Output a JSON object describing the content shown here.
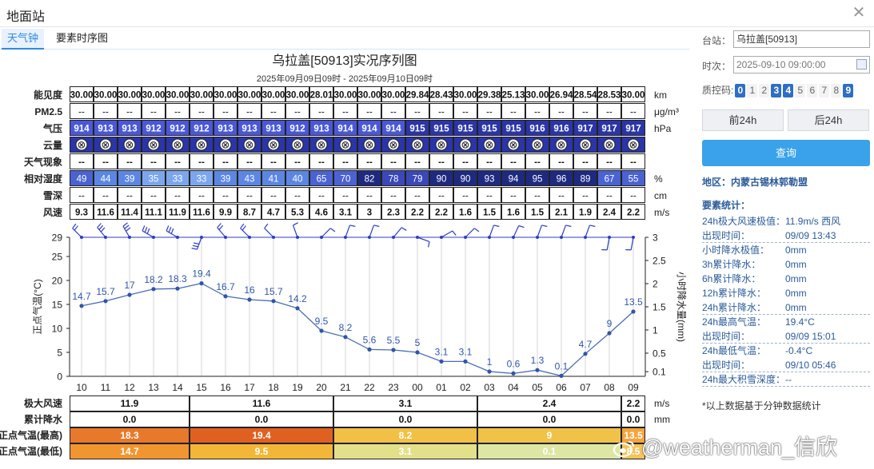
{
  "window": {
    "title": "地面站"
  },
  "tabs": [
    {
      "label": "天气钟",
      "active": true
    },
    {
      "label": "要素时序图",
      "active": false
    }
  ],
  "chart_data": {
    "type": "line",
    "title": "乌拉盖[50913]实况序列图",
    "subtitle": "2025年09月09日09时 - 2025年09月10日09时",
    "hours": [
      "10",
      "11",
      "12",
      "13",
      "14",
      "15",
      "16",
      "17",
      "18",
      "19",
      "20",
      "21",
      "22",
      "23",
      "00",
      "01",
      "02",
      "03",
      "04",
      "05",
      "06",
      "07",
      "08",
      "09"
    ],
    "table_rows": [
      {
        "label": "能见度",
        "unit": "km",
        "style": "plain-bold",
        "values": [
          "30.00",
          "30.00",
          "30.00",
          "30.00",
          "30.00",
          "30.00",
          "30.00",
          "30.00",
          "30.00",
          "30.00",
          "28.01",
          "30.00",
          "30.00",
          "30.00",
          "29.84",
          "28.43",
          "30.00",
          "29.38",
          "25.13",
          "30.00",
          "26.94",
          "28.54",
          "28.53",
          "30.00"
        ]
      },
      {
        "label": "PM2.5",
        "unit": "μg/m³",
        "style": "plain",
        "values": [
          "--",
          "--",
          "--",
          "--",
          "--",
          "--",
          "--",
          "--",
          "--",
          "--",
          "--",
          "--",
          "--",
          "--",
          "--",
          "--",
          "--",
          "--",
          "--",
          "--",
          "--",
          "--",
          "--",
          "--"
        ]
      },
      {
        "label": "气压",
        "unit": "hPa",
        "style": "pressure",
        "values": [
          "914",
          "913",
          "913",
          "912",
          "912",
          "912",
          "913",
          "913",
          "913",
          "912",
          "913",
          "914",
          "914",
          "914",
          "915",
          "915",
          "915",
          "915",
          "915",
          "916",
          "916",
          "917",
          "917",
          "917"
        ]
      },
      {
        "label": "云量",
        "unit": "",
        "style": "cloud",
        "values": [
          "⊗",
          "⊗",
          "⊗",
          "⊗",
          "⊗",
          "⊗",
          "⊗",
          "⊗",
          "⊗",
          "⊗",
          "⊗",
          "⊗",
          "⊗",
          "⊗",
          "⊗",
          "⊗",
          "⊗",
          "⊗",
          "⊗",
          "⊗",
          "⊗",
          "⊗",
          "⊗",
          "⊗"
        ]
      },
      {
        "label": "天气现象",
        "unit": "",
        "style": "plain-bold",
        "values": [
          "--",
          "--",
          "--",
          "--",
          "--",
          "--",
          "--",
          "--",
          "--",
          "--",
          "--",
          "--",
          "--",
          "--",
          "--",
          "--",
          "--",
          "--",
          "--",
          "--",
          "--",
          "--",
          "--",
          "--"
        ]
      },
      {
        "label": "相对湿度",
        "unit": "%",
        "style": "humidity",
        "values": [
          "49",
          "44",
          "39",
          "35",
          "33",
          "33",
          "39",
          "43",
          "41",
          "40",
          "65",
          "70",
          "82",
          "78",
          "79",
          "90",
          "90",
          "93",
          "94",
          "95",
          "96",
          "89",
          "67",
          "55"
        ]
      },
      {
        "label": "雪深",
        "unit": "cm",
        "style": "plain",
        "values": [
          "--",
          "--",
          "--",
          "--",
          "--",
          "--",
          "--",
          "--",
          "--",
          "--",
          "--",
          "--",
          "--",
          "--",
          "--",
          "--",
          "--",
          "--",
          "--",
          "--",
          "--",
          "--",
          "--",
          "--"
        ]
      },
      {
        "label": "风速",
        "unit": "m/s",
        "style": "plain-bold",
        "values": [
          "9.3",
          "11.6",
          "11.4",
          "11.1",
          "11.9",
          "11.6",
          "9.9",
          "8.7",
          "4.7",
          "5.3",
          "4.6",
          "3.1",
          "3",
          "2.3",
          "2.2",
          "2.2",
          "1.6",
          "1.5",
          "1.6",
          "1.5",
          "2.1",
          "1.9",
          "2.4",
          "2.2"
        ]
      }
    ],
    "temperature": {
      "name": "正点气温(°C)",
      "values": [
        14.7,
        15.7,
        17,
        18.2,
        18.3,
        19.4,
        16.7,
        16,
        15.7,
        14.2,
        9.5,
        8.2,
        5.6,
        5.5,
        5,
        3.1,
        3.1,
        1,
        0.6,
        1.3,
        0.1,
        4.7,
        9,
        13.5
      ]
    },
    "precip_1h": {
      "name": "小时降水量(mm)",
      "values": [
        0,
        0,
        0,
        0,
        0,
        0,
        0,
        0,
        0,
        0,
        0,
        0,
        0,
        0,
        0,
        0,
        0,
        0,
        0,
        0,
        0,
        0,
        0,
        0
      ]
    },
    "left_axis": {
      "label": "正点气温(°C)",
      "ylim": [
        0,
        29
      ],
      "ticks": [
        "29",
        "25",
        "20",
        "15",
        "10",
        "5",
        "0"
      ]
    },
    "right_axis": {
      "label": "小时降水量(mm)",
      "ylim": [
        0,
        3
      ],
      "ticks": [
        "3",
        "2.5",
        "2",
        "1.5",
        "1",
        "0.5",
        "0.1"
      ]
    },
    "wind_dir_deg": [
      315,
      320,
      330,
      300,
      300,
      200,
      320,
      315,
      315,
      340,
      45,
      20,
      20,
      40,
      110,
      60,
      45,
      20,
      25,
      20,
      20,
      20,
      190,
      190
    ],
    "summary_rows": [
      {
        "label": "极大风速",
        "unit": "m/s",
        "groups": [
          {
            "span": 5,
            "value": "11.9"
          },
          {
            "span": 6,
            "value": "11.6"
          },
          {
            "span": 6,
            "value": "3.1"
          },
          {
            "span": 6,
            "value": "2.4"
          },
          {
            "span": 1,
            "value": "2.2"
          }
        ]
      },
      {
        "label": "累计降水",
        "unit": "mm",
        "groups": [
          {
            "span": 5,
            "value": "0.0"
          },
          {
            "span": 6,
            "value": "0.0"
          },
          {
            "span": 6,
            "value": "0.0"
          },
          {
            "span": 6,
            "value": "0.0"
          },
          {
            "span": 1,
            "value": "0.0"
          }
        ]
      },
      {
        "label": "正点气温(最高)",
        "unit": "",
        "groups": [
          {
            "span": 5,
            "value": "18.3",
            "color": "#e8792a"
          },
          {
            "span": 6,
            "value": "19.4",
            "color": "#e0601f"
          },
          {
            "span": 6,
            "value": "8.2",
            "color": "#f2c044"
          },
          {
            "span": 6,
            "value": "9",
            "color": "#f1c248"
          },
          {
            "span": 1,
            "value": "13.5",
            "color": "#f5a43a"
          }
        ]
      },
      {
        "label": "正点气温(最低)",
        "unit": "",
        "groups": [
          {
            "span": 5,
            "value": "14.7",
            "color": "#f19530"
          },
          {
            "span": 6,
            "value": "9.5",
            "color": "#f3b737"
          },
          {
            "span": 6,
            "value": "3.1",
            "color": "#e3e08a"
          },
          {
            "span": 6,
            "value": "0.1",
            "color": "#dde7a3"
          },
          {
            "span": 1,
            "value": "8.5",
            "color": "#f4c45a"
          }
        ]
      }
    ]
  },
  "sidebar": {
    "station_label": "台站：",
    "station_value": "乌拉盖[50913]",
    "time_label": "时次：",
    "time_value": "2025-09-10 09:00:00",
    "qc_label": "质控码:",
    "qc_codes": [
      {
        "code": "0",
        "on": true
      },
      {
        "code": "1",
        "on": false
      },
      {
        "code": "2",
        "on": false
      },
      {
        "code": "3",
        "on": true
      },
      {
        "code": "4",
        "on": true
      },
      {
        "code": "5",
        "on": false
      },
      {
        "code": "6",
        "on": false
      },
      {
        "code": "7",
        "on": false
      },
      {
        "code": "8",
        "on": false
      },
      {
        "code": "9",
        "on": true
      }
    ],
    "prev_btn": "前24h",
    "next_btn": "后24h",
    "query_btn": "查询",
    "region": "地区：内蒙古锡林郭勒盟",
    "stats_title": "要素统计：",
    "stats": [
      {
        "k": "24h极大风速极值：",
        "v": "11.9m/s 西风",
        "dash": false
      },
      {
        "k": "出现时间：",
        "v": "09/09 13:43",
        "dash": true
      },
      {
        "k": "小时降水极值：",
        "v": "0mm",
        "dash": false
      },
      {
        "k": "3h累计降水：",
        "v": "0mm",
        "dash": false
      },
      {
        "k": "6h累计降水：",
        "v": "0mm",
        "dash": false
      },
      {
        "k": "12h累计降水：",
        "v": "0mm",
        "dash": false
      },
      {
        "k": "24h累计降水：",
        "v": "0mm",
        "dash": true
      },
      {
        "k": "24h最高气温：",
        "v": "19.4°C",
        "dash": false
      },
      {
        "k": "出现时间：",
        "v": "09/09 15:01",
        "dash": true
      },
      {
        "k": "24h最低气温：",
        "v": "-0.4°C",
        "dash": false
      },
      {
        "k": "出现时间：",
        "v": "09/10 05:46",
        "dash": true
      },
      {
        "k": "24h最大积雪深度：",
        "v": "--",
        "dash": true
      }
    ],
    "note": "*以上数据基于分钟数据统计"
  },
  "watermark": "@weatherman_信欣"
}
